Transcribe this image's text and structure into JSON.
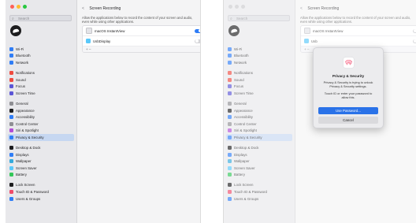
{
  "colors": {
    "accent": "#2f7df6",
    "primary_button": "#2a72e8",
    "traffic_red": "#ff5f57",
    "traffic_yellow": "#febc2e",
    "traffic_green": "#28c840",
    "sidebar_selected": "#c6d7f1"
  },
  "sidebar": {
    "search_placeholder": "Search",
    "groups": [
      [
        {
          "label": "Wi-Fi",
          "icon": "wifi-icon",
          "color": "#2f7df6"
        },
        {
          "label": "Bluetooth",
          "icon": "bluetooth-icon",
          "color": "#2f7df6"
        },
        {
          "label": "Network",
          "icon": "network-icon",
          "color": "#2f7df6"
        }
      ],
      [
        {
          "label": "Notifications",
          "icon": "notifications-icon",
          "color": "#ef4b3f"
        },
        {
          "label": "Sound",
          "icon": "sound-icon",
          "color": "#ef4b3f"
        },
        {
          "label": "Focus",
          "icon": "focus-icon",
          "color": "#5b55d6"
        },
        {
          "label": "Screen Time",
          "icon": "screen-time-icon",
          "color": "#5b55d6"
        }
      ],
      [
        {
          "label": "General",
          "icon": "general-icon",
          "color": "#8e8e93"
        },
        {
          "label": "Appearance",
          "icon": "appearance-icon",
          "color": "#1c1c1e"
        },
        {
          "label": "Accessibility",
          "icon": "accessibility-icon",
          "color": "#2f7df6"
        },
        {
          "label": "Control Center",
          "icon": "control-center-icon",
          "color": "#8e8e93"
        },
        {
          "label": "Siri & Spotlight",
          "icon": "siri-icon",
          "color": "#b14cd6"
        },
        {
          "label": "Privacy & Security",
          "icon": "privacy-icon",
          "color": "#2f7df6",
          "selected": true
        }
      ],
      [
        {
          "label": "Desktop & Dock",
          "icon": "desktop-dock-icon",
          "color": "#1c1c1e"
        },
        {
          "label": "Displays",
          "icon": "displays-icon",
          "color": "#2f7df6"
        },
        {
          "label": "Wallpaper",
          "icon": "wallpaper-icon",
          "color": "#34aadc"
        },
        {
          "label": "Screen Saver",
          "icon": "screen-saver-icon",
          "color": "#5ac8fa"
        },
        {
          "label": "Battery",
          "icon": "battery-icon",
          "color": "#34c759"
        }
      ],
      [
        {
          "label": "Lock Screen",
          "icon": "lock-screen-icon",
          "color": "#1c1c1e"
        },
        {
          "label": "Touch ID & Password",
          "icon": "touch-id-icon",
          "color": "#ef4b6a"
        },
        {
          "label": "Users & Groups",
          "icon": "users-groups-icon",
          "color": "#2f7df6"
        }
      ]
    ]
  },
  "content": {
    "back": "<",
    "title": "Screen Recording",
    "description": "Allow the applications below to record the content of your screen and audio, even while using other applications.",
    "apps": [
      {
        "name": "macOS InstantView",
        "enabled": true
      },
      {
        "name": "UsbDisplay",
        "enabled": false
      }
    ],
    "add_remove": "+   –"
  },
  "right_panel": {
    "app2_partial": "Usb"
  },
  "dialog": {
    "title": "Privacy & Security",
    "message": "Privacy & Security is trying to unlock Privacy & Security settings.",
    "touch_prompt": "Touch ID or enter your password to allow this.",
    "primary_button": "Use Password...",
    "cancel_button": "Cancel"
  }
}
